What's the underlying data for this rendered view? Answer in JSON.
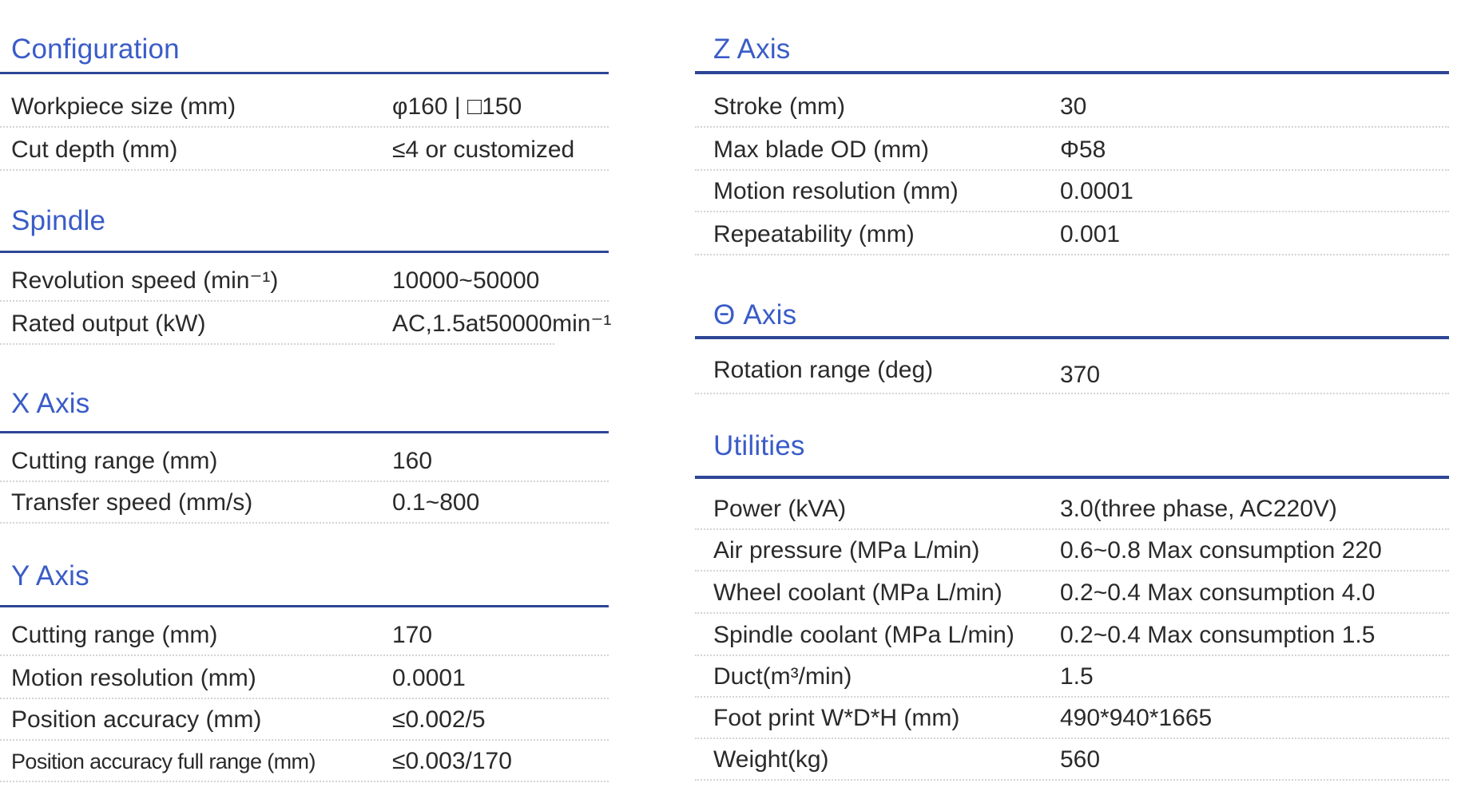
{
  "sections_left": [
    {
      "title": "Configuration",
      "rows": [
        {
          "label": "Workpiece size (mm)",
          "value": "φ160 | □150"
        },
        {
          "label": "Cut depth (mm)",
          "value": "≤4 or customized"
        }
      ]
    },
    {
      "title": "Spindle",
      "rows": [
        {
          "label": "Revolution speed (min⁻¹)",
          "value": "10000~50000"
        },
        {
          "label": "Rated output (kW)",
          "value": "AC,1.5at50000min⁻¹"
        }
      ]
    },
    {
      "title": "X Axis",
      "rows": [
        {
          "label": "Cutting range (mm)",
          "value": "160"
        },
        {
          "label": "Transfer speed (mm/s)",
          "value": "0.1~800"
        }
      ]
    },
    {
      "title": "Y Axis",
      "rows": [
        {
          "label": "Cutting range (mm)",
          "value": "170"
        },
        {
          "label": "Motion resolution (mm)",
          "value": "0.0001"
        },
        {
          "label": "Position accuracy (mm)",
          "value": "≤0.002/5"
        },
        {
          "label": "Position accuracy full range (mm)",
          "value": "≤0.003/170"
        }
      ]
    }
  ],
  "sections_right": [
    {
      "title": "Z Axis",
      "rows": [
        {
          "label": "Stroke (mm)",
          "value": "30"
        },
        {
          "label": "Max blade OD (mm)",
          "value": "Φ58"
        },
        {
          "label": "Motion resolution (mm)",
          "value": "0.0001"
        },
        {
          "label": "Repeatability (mm)",
          "value": "0.001"
        }
      ]
    },
    {
      "title": "Θ Axis",
      "rows": [
        {
          "label": "Rotation range (deg)",
          "value": "370"
        }
      ]
    },
    {
      "title": "Utilities",
      "rows": [
        {
          "label": "Power (kVA)",
          "value": "3.0(three phase, AC220V)"
        },
        {
          "label": "Air pressure (MPa  L/min)",
          "value": "0.6~0.8 Max consumption 220"
        },
        {
          "label": "Wheel coolant (MPa   L/min)",
          "value": "0.2~0.4 Max consumption 4.0"
        },
        {
          "label": "Spindle coolant (MPa   L/min)",
          "value": "0.2~0.4 Max consumption 1.5"
        },
        {
          "label": "Duct(m³/min)",
          "value": "1.5"
        },
        {
          "label": "Foot print W*D*H (mm)",
          "value": "490*940*1665"
        },
        {
          "label": "Weight(kg)",
          "value": "560"
        }
      ]
    }
  ]
}
